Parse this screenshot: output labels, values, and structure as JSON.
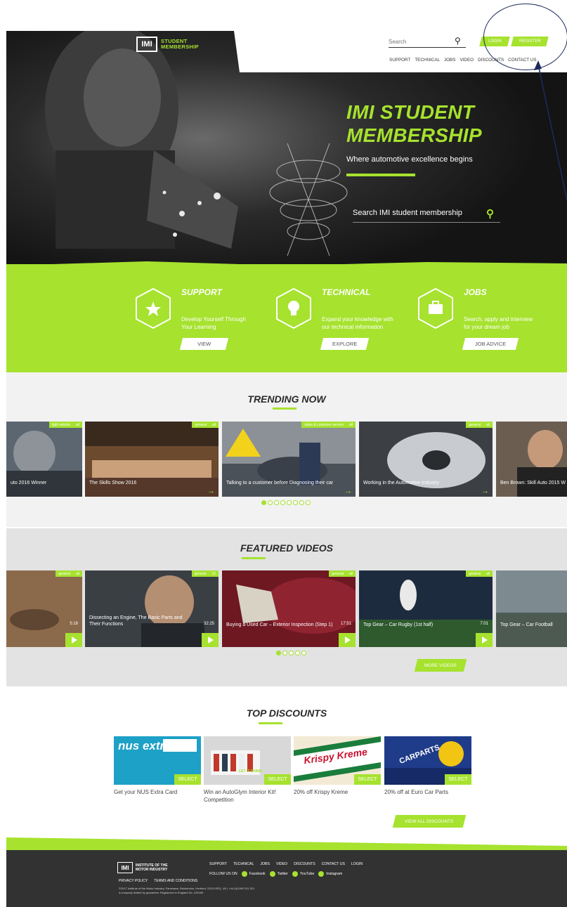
{
  "header": {
    "logo_mark": "IMI",
    "logo_line1": "STUDENT",
    "logo_line2": "MEMBERSHIP",
    "search_placeholder": "Search",
    "login": "LOGIN",
    "register": "REGISTER",
    "nav": [
      "SUPPORT",
      "TECHNICAL",
      "JOBS",
      "VIDEO",
      "DISCOUNTS",
      "CONTACT US"
    ]
  },
  "hero": {
    "title_line1": "IMI STUDENT",
    "title_line2": "MEMBERSHIP",
    "subtitle": "Where automotive excellence begins",
    "search_text": "Search IMI student membership"
  },
  "features": [
    {
      "title": "SUPPORT",
      "desc_line1": "Develop Yourself Through",
      "desc_line2": "Your Learning",
      "button": "VIEW",
      "icon": "star-icon"
    },
    {
      "title": "TECHNICAL",
      "desc_line1": "Expand your knowledge with",
      "desc_line2": "our technical information",
      "button": "EXPLORE",
      "icon": "lightbulb-icon"
    },
    {
      "title": "JOBS",
      "desc_line1": "Search, apply and interview",
      "desc_line2": "for your dream job",
      "button": "JOB ADVICE",
      "icon": "briefcase-icon"
    }
  ],
  "trending": {
    "title": "TRENDING NOW",
    "cards": [
      {
        "tag": "light vehicle",
        "tag2": "all",
        "caption": "uto 2016 Winner"
      },
      {
        "tag": "general",
        "tag2": "all",
        "caption": "The Skills Show 2016"
      },
      {
        "tag": "sales & customer service",
        "tag2": "all",
        "caption": "Talking to a customer before Diagnosing their car"
      },
      {
        "tag": "general",
        "tag2": "all",
        "caption": "Working in the Automotive Industry"
      },
      {
        "tag": "",
        "tag2": "",
        "caption": "Ben Brown: Skill Auto 2015 W"
      }
    ]
  },
  "videos": {
    "title": "FEATURED VIDEOS",
    "cards": [
      {
        "tag": "general",
        "tag2": "all",
        "caption": "",
        "duration": "5:18"
      },
      {
        "tag": "general",
        "tag2": "12",
        "caption": "Dissecting an Engine, The Basic Parts and Their Functions",
        "duration": "32:25"
      },
      {
        "tag": "general",
        "tag2": "all",
        "caption": "Buying a Used Car – Exterior Inspection (Step 1)",
        "duration": "17:51"
      },
      {
        "tag": "general",
        "tag2": "all",
        "caption": "Top Gear – Car Rugby (1st half)",
        "duration": "7:01"
      },
      {
        "tag": "",
        "tag2": "",
        "caption": "Top Gear – Car Football",
        "duration": ""
      }
    ],
    "more": "MORE VIDEOS"
  },
  "discounts": {
    "title": "TOP DISCOUNTS",
    "select": "SELECT",
    "items": [
      {
        "label_line1": "Get your NUS Extra Card",
        "label_line2": "",
        "image_text": "nus extra"
      },
      {
        "label_line1": "Win an AutoGlym Interior Kit!",
        "label_line2": "Competition",
        "image_text": "LET IT SHINE!"
      },
      {
        "label_line1": "20% off Krispy Kreme",
        "label_line2": "",
        "image_text": "Krispy Kreme"
      },
      {
        "label_line1": "20% off at Euro Car Parts",
        "label_line2": "",
        "image_text": "CARPARTS"
      }
    ],
    "view_all": "VIEW ALL DISCOUNTS"
  },
  "footer": {
    "logo_mark": "IMI",
    "logo_line1": "INSTITUTE OF THE",
    "logo_line2": "MOTOR INDUSTRY",
    "nav": [
      "SUPPORT",
      "TECHNICAL",
      "JOBS",
      "VIDEO",
      "DISCOUNTS",
      "CONTACT US",
      "LOGIN"
    ],
    "follow": "FOLLOW US ON",
    "social": [
      "Facebook",
      "Twitter",
      "YouTube",
      "Instagram"
    ],
    "legal": [
      "PRIVACY POLICY",
      "TERMS AND CONDITIONS"
    ],
    "copy_line1": "©2017 Institute of the Motor Industry, Fanshaws, Brickendon, Hertford, SG13 8PQ, UK | +44 (0)1992 511 521",
    "copy_line2": "A company limited by guarantee. Registered in England No. 225180"
  },
  "colors": {
    "accent": "#a6e22e",
    "dark": "#323232",
    "annotation": "#1b2a5c"
  }
}
